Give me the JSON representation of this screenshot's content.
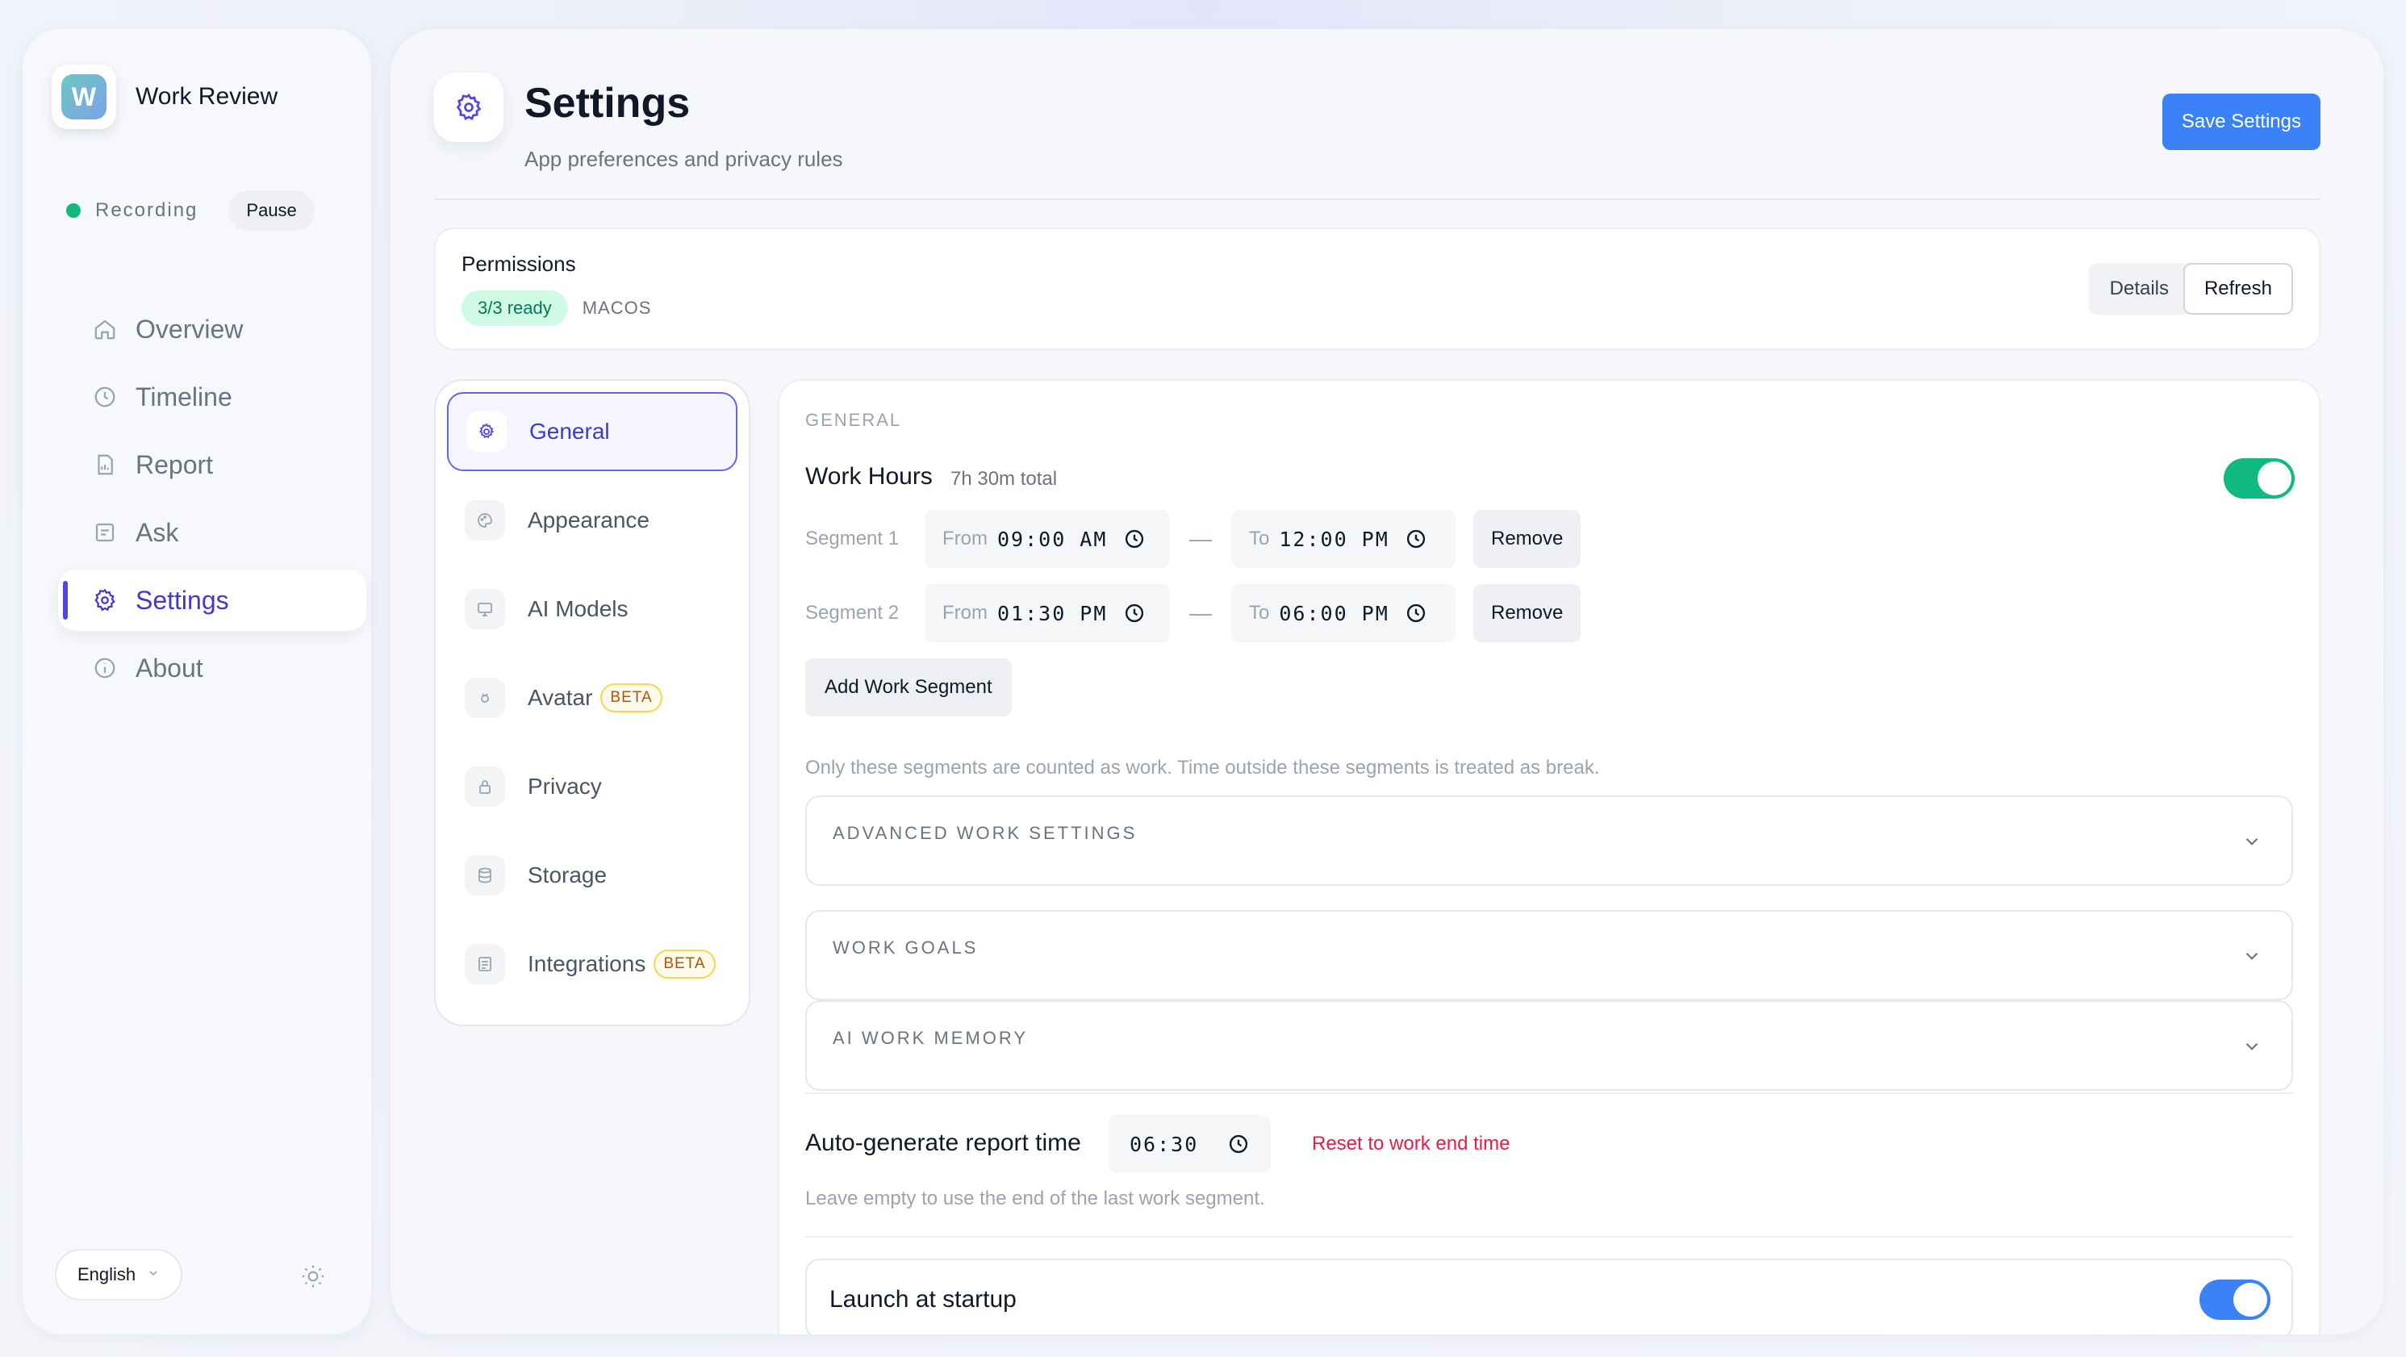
{
  "app": {
    "name": "Work Review",
    "logo_letter": "W"
  },
  "recording": {
    "status": "Recording",
    "pause_label": "Pause"
  },
  "nav": {
    "items": [
      {
        "label": "Overview",
        "icon": "home-icon"
      },
      {
        "label": "Timeline",
        "icon": "clock-icon"
      },
      {
        "label": "Report",
        "icon": "report-icon"
      },
      {
        "label": "Ask",
        "icon": "chat-icon"
      },
      {
        "label": "Settings",
        "icon": "gear-icon",
        "active": true
      },
      {
        "label": "About",
        "icon": "info-icon"
      }
    ]
  },
  "language": {
    "selected": "English"
  },
  "header": {
    "title": "Settings",
    "subtitle": "App preferences and privacy rules",
    "save_label": "Save Settings"
  },
  "permissions": {
    "title": "Permissions",
    "status": "3/3 ready",
    "os": "MACOS",
    "details_label": "Details",
    "refresh_label": "Refresh"
  },
  "settings_nav": {
    "items": [
      {
        "label": "General",
        "icon": "gear-icon",
        "active": true
      },
      {
        "label": "Appearance",
        "icon": "palette-icon"
      },
      {
        "label": "AI Models",
        "icon": "monitor-icon"
      },
      {
        "label": "Avatar",
        "icon": "avatar-icon",
        "badge": "BETA"
      },
      {
        "label": "Privacy",
        "icon": "lock-icon"
      },
      {
        "label": "Storage",
        "icon": "database-icon"
      },
      {
        "label": "Integrations",
        "icon": "integrations-icon",
        "badge": "BETA"
      }
    ]
  },
  "general": {
    "section_label": "GENERAL",
    "work_hours": {
      "title": "Work Hours",
      "total": "7h 30m total",
      "enabled": true
    },
    "segments": [
      {
        "label": "Segment 1",
        "from_prefix": "From",
        "from": "09:00 AM",
        "to_prefix": "To",
        "to": "12:00 PM",
        "remove_label": "Remove"
      },
      {
        "label": "Segment 2",
        "from_prefix": "From",
        "from": "01:30 PM",
        "to_prefix": "To",
        "to": "06:00 PM",
        "remove_label": "Remove"
      }
    ],
    "separator": "—",
    "add_segment_label": "Add Work Segment",
    "segments_hint": "Only these segments are counted as work. Time outside these segments is treated as break.",
    "accordions": [
      {
        "label": "ADVANCED WORK SETTINGS"
      },
      {
        "label": "WORK GOALS"
      },
      {
        "label": "AI WORK MEMORY"
      }
    ],
    "auto_report": {
      "label": "Auto-generate report time",
      "value": "06:30",
      "reset_label": "Reset to work end time",
      "hint": "Leave empty to use the end of the last work segment."
    },
    "launch_at_startup": {
      "label": "Launch at startup",
      "enabled": true
    }
  },
  "colors": {
    "accent": "#4f46e5",
    "primary_button": "#3b82f6",
    "success": "#10b981",
    "danger": "#e11d48"
  }
}
